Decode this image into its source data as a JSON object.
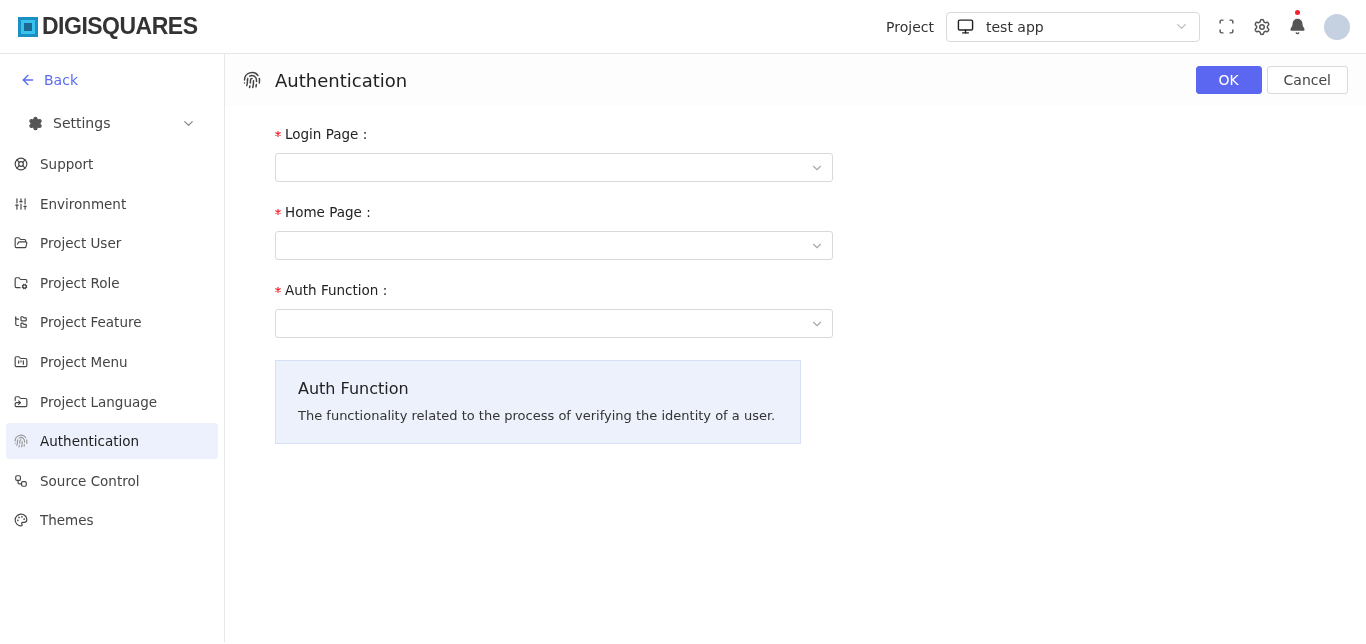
{
  "header": {
    "logo": "DIGISQUARES",
    "project_label": "Project",
    "project_value": "test app",
    "notification_dot": true
  },
  "sidebar": {
    "back": "Back",
    "group": {
      "label": "Settings",
      "expanded": true
    },
    "items": [
      {
        "label": "Support",
        "selected": false
      },
      {
        "label": "Environment",
        "selected": false
      },
      {
        "label": "Project User",
        "selected": false
      },
      {
        "label": "Project Role",
        "selected": false
      },
      {
        "label": "Project Feature",
        "selected": false
      },
      {
        "label": "Project Menu",
        "selected": false
      },
      {
        "label": "Project Language",
        "selected": false
      },
      {
        "label": "Authentication",
        "selected": true
      },
      {
        "label": "Source Control",
        "selected": false
      },
      {
        "label": "Themes",
        "selected": false
      }
    ]
  },
  "page": {
    "title": "Authentication",
    "buttons": [
      {
        "label": "OK",
        "kind": "primary"
      },
      {
        "label": "Cancel",
        "kind": "default"
      }
    ],
    "fields": [
      {
        "label": "Login Page :",
        "required": true
      },
      {
        "label": "Home Page :",
        "required": true
      },
      {
        "label": "Auth Function :",
        "required": true
      }
    ],
    "info": {
      "title": "Auth Function",
      "text": "The functionality related to the process of verifying the identity of a user."
    }
  }
}
